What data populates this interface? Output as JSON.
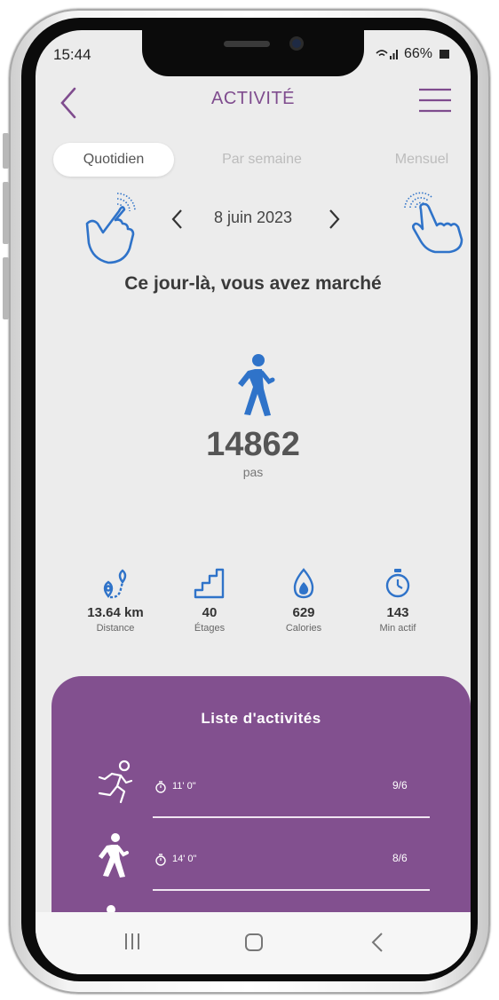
{
  "status_bar": {
    "time": "15:44",
    "battery": "66%"
  },
  "header": {
    "title": "ACTIVITÉ"
  },
  "tabs": [
    {
      "label": "Quotidien",
      "active": true
    },
    {
      "label": "Par semaine",
      "active": false
    },
    {
      "label": "Mensuel",
      "active": false
    }
  ],
  "date_nav": {
    "date": "8 juin 2023"
  },
  "summary": {
    "heading": "Ce jour-là, vous avez marché",
    "steps": "14862",
    "unit": "pas"
  },
  "stats": [
    {
      "icon": "map-route-icon",
      "value": "13.64 km",
      "label": "Distance"
    },
    {
      "icon": "stairs-icon",
      "value": "40",
      "label": "Étages"
    },
    {
      "icon": "flame-icon",
      "value": "629",
      "label": "Calories"
    },
    {
      "icon": "stopwatch-icon",
      "value": "143",
      "label": "Min actif"
    }
  ],
  "activity_list": {
    "title": "Liste d'activités",
    "items": [
      {
        "icon": "running-icon",
        "duration": "11' 0\"",
        "date": "9/6"
      },
      {
        "icon": "walking-icon",
        "duration": "14' 0\"",
        "date": "8/6"
      }
    ]
  },
  "colors": {
    "accent": "#82508f",
    "title": "#7f4c8e",
    "icon_blue": "#2f73c9",
    "background": "#ececec"
  }
}
